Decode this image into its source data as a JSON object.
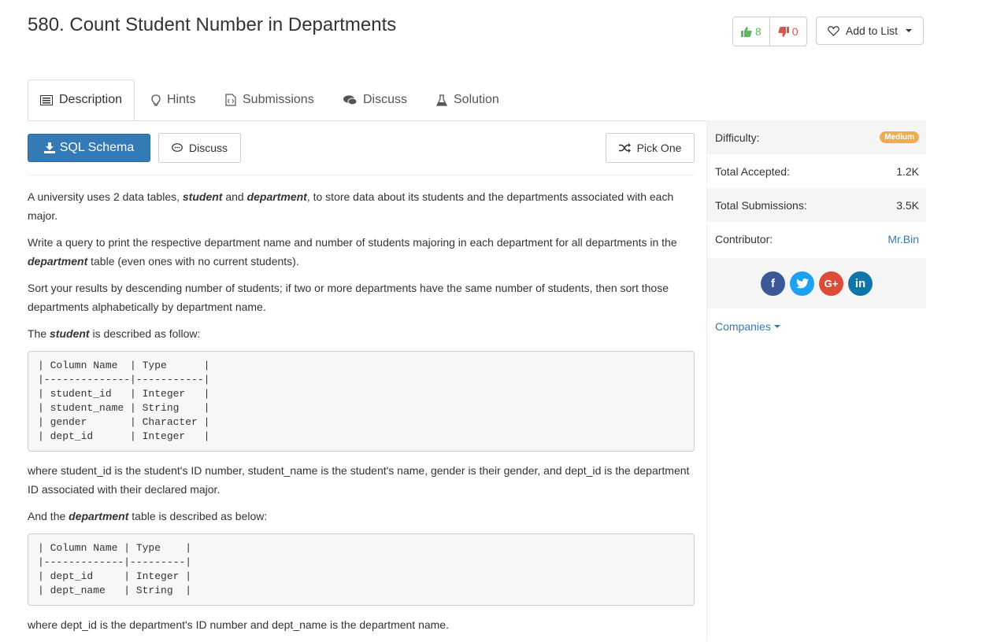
{
  "problem": {
    "title": "580. Count Student Number in Departments"
  },
  "votes": {
    "up": "8",
    "down": "0"
  },
  "add_to_list": "Add to List",
  "tabs": [
    {
      "label": "Description",
      "icon": "list-icon"
    },
    {
      "label": "Hints",
      "icon": "lightbulb-icon"
    },
    {
      "label": "Submissions",
      "icon": "code-file-icon"
    },
    {
      "label": "Discuss",
      "icon": "comments-icon"
    },
    {
      "label": "Solution",
      "icon": "flask-icon"
    }
  ],
  "toolbar": {
    "schema": "SQL Schema",
    "discuss": "Discuss",
    "pick": "Pick One"
  },
  "description": {
    "p1_a": "A university uses 2 data tables, ",
    "p1_b": "student",
    "p1_c": " and ",
    "p1_d": "department",
    "p1_e": ", to store data about its students and the departments associated with each major.",
    "p2_a": "Write a query to print the respective department name and number of students majoring in each department for all departments in the ",
    "p2_b": "department",
    "p2_c": " table (even ones with no current students).",
    "p3": "Sort your results by descending number of students; if two or more departments have the same number of students, then sort those departments alphabetically by department name.",
    "p4_a": "The ",
    "p4_b": "student",
    "p4_c": " is described as follow:",
    "code1": "| Column Name  | Type      |\n|--------------|-----------|\n| student_id   | Integer   |\n| student_name | String    |\n| gender       | Character |\n| dept_id      | Integer   |",
    "p5": "where student_id is the student's ID number, student_name is the student's name, gender is their gender, and dept_id is the department ID associated with their declared major.",
    "p6_a": "And the ",
    "p6_b": "department",
    "p6_c": " table is described as below:",
    "code2": "| Column Name | Type    |\n|-------------|---------|\n| dept_id     | Integer |\n| dept_name   | String  |",
    "p7": "where dept_id is the department's ID number and dept_name is the department name."
  },
  "sidebar": {
    "difficulty_label": "Difficulty:",
    "difficulty": "Medium",
    "accepted_label": "Total Accepted:",
    "accepted": "1.2K",
    "submissions_label": "Total Submissions:",
    "submissions": "3.5K",
    "contributor_label": "Contributor:",
    "contributor": "Mr.Bin",
    "companies": "Companies",
    "social": [
      {
        "name": "facebook-icon",
        "glyph": "f",
        "color": "#3b5998"
      },
      {
        "name": "twitter-icon",
        "glyph": "t",
        "color": "#1da1f2"
      },
      {
        "name": "google-plus-icon",
        "glyph": "G+",
        "color": "#dd4b39"
      },
      {
        "name": "linkedin-icon",
        "glyph": "in",
        "color": "#0e76a8"
      }
    ]
  }
}
